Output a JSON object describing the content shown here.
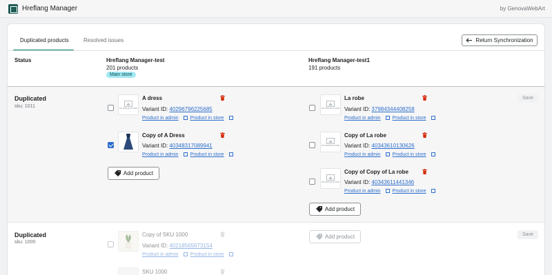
{
  "app": {
    "title": "Hreflang Manager",
    "by": "by GenovaWebArt"
  },
  "tabs": [
    {
      "label": "Duplicated products"
    },
    {
      "label": "Resolved issues"
    }
  ],
  "return_button": {
    "label": "Return Synchronization"
  },
  "header": {
    "status_label": "Status",
    "store1": {
      "name": "Hreflang Manager-test",
      "count": "201 products",
      "badge": "Main store"
    },
    "store2": {
      "name": "Hreflang Manager-test1",
      "count": "191 products"
    }
  },
  "groups": [
    {
      "title": "Duplicated",
      "sku": "sku: 1011",
      "save_label": "Save",
      "left": [
        {
          "name": "A dress",
          "variant_prefix": "Variant ID: ",
          "variant_id": "40296796225685",
          "link_admin": "Product in admin",
          "link_store": "Product in store",
          "checked": false
        },
        {
          "name": "Copy of A Dress",
          "variant_prefix": "Variant ID: ",
          "variant_id": "40348317089941",
          "link_admin": "Product in admin",
          "link_store": "Product in store",
          "checked": true
        }
      ],
      "right": [
        {
          "name": "La robe",
          "variant_prefix": "Variant ID: ",
          "variant_id": "37984344408258",
          "link_admin": "Product in admin",
          "link_store": "Product in store",
          "checked": false
        },
        {
          "name": "Copy of La robe",
          "variant_prefix": "Variant ID: ",
          "variant_id": "40343610130626",
          "link_admin": "Product in admin",
          "link_store": "Product in store",
          "checked": false
        },
        {
          "name": "Copy of Copy of La robe",
          "variant_prefix": "Variant ID: ",
          "variant_id": "40343611441346",
          "link_admin": "Product in admin",
          "link_store": "Product in store",
          "checked": false
        }
      ],
      "add_left": "Add product",
      "add_right": "Add product"
    },
    {
      "title": "Duplicated",
      "sku": "sku: 1000",
      "save_label": "Save",
      "left": [
        {
          "name": "Copy of SKU 1000",
          "variant_prefix": "Variant ID: ",
          "variant_id": "40218565673154",
          "link_admin": "Product in admin",
          "link_store": "Product in store",
          "checked": false
        },
        {
          "name": "SKU 1000"
        }
      ],
      "add_right": "Add product"
    }
  ],
  "no_image_text": "NO IMAGE FOUND",
  "colors": {
    "accent": "#008060",
    "link": "#2c6ecb",
    "badge_bg": "#a4e8f2",
    "trash": "#d72c0d"
  },
  "icons": {
    "trash": "trash-icon",
    "external": "external-link-icon",
    "arrow": "arrow-left-icon",
    "add": "add-product-icon"
  }
}
